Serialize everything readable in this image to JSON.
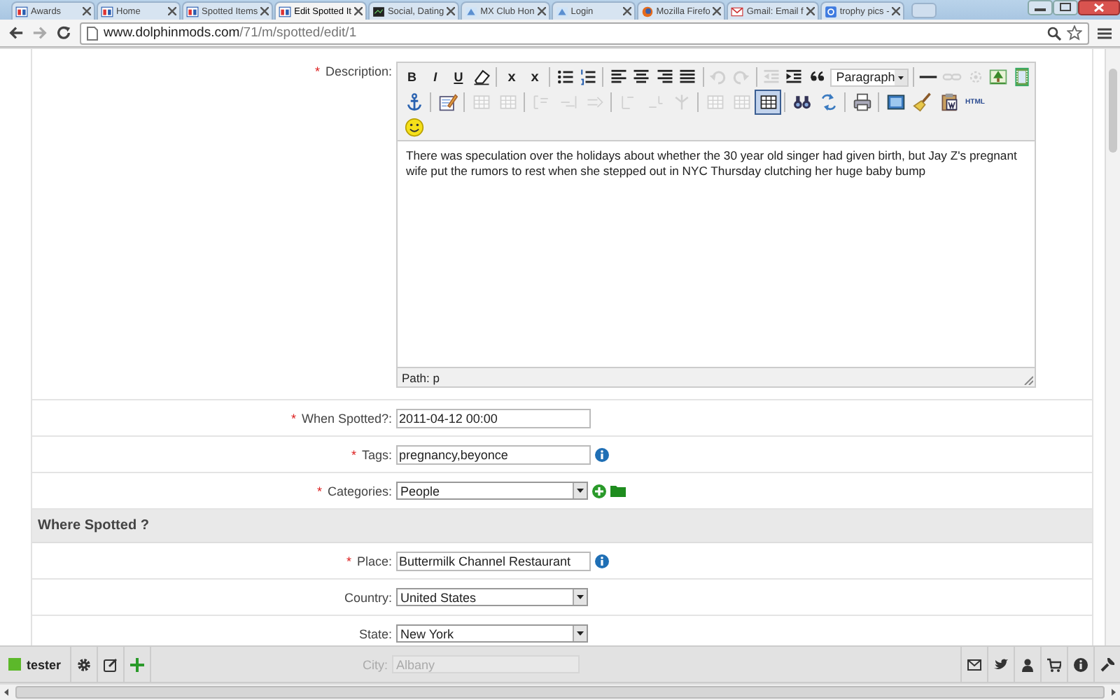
{
  "browser": {
    "tabs": [
      {
        "label": "Awards",
        "selected": false
      },
      {
        "label": "Home",
        "selected": false
      },
      {
        "label": "Spotted Items",
        "selected": false
      },
      {
        "label": "Edit Spotted It",
        "selected": true
      },
      {
        "label": "Social, Dating",
        "selected": false
      },
      {
        "label": "MX Club Hon",
        "selected": false
      },
      {
        "label": "Login",
        "selected": false
      },
      {
        "label": "Mozilla Firefo",
        "selected": false
      },
      {
        "label": "Gmail: Email f",
        "selected": false
      },
      {
        "label": "trophy pics -",
        "selected": false
      }
    ],
    "address": {
      "host": "www.dolphinmods.com",
      "path": "/71/m/spotted/edit/1"
    }
  },
  "description": {
    "label": "Description:",
    "marker": "*",
    "toolbar_rows": [
      [
        {
          "kind": "bold",
          "label": "B",
          "disabled": false,
          "active": false
        },
        {
          "kind": "italic",
          "label": "I",
          "disabled": false,
          "active": false
        },
        {
          "kind": "underline",
          "label": "U",
          "disabled": false,
          "active": false
        },
        {
          "kind": "eraser",
          "disabled": false,
          "active": false
        },
        {
          "kind": "separator"
        },
        {
          "kind": "subscript",
          "label": "x",
          "disabled": false,
          "active": false
        },
        {
          "kind": "superscript",
          "label": "x",
          "disabled": false,
          "active": false
        },
        {
          "kind": "separator"
        },
        {
          "kind": "bullets",
          "disabled": false,
          "active": false
        },
        {
          "kind": "numbers",
          "disabled": false,
          "active": false
        },
        {
          "kind": "separator"
        },
        {
          "kind": "align-left",
          "disabled": false,
          "active": false
        },
        {
          "kind": "align-center",
          "disabled": false,
          "active": false
        },
        {
          "kind": "align-right",
          "disabled": false,
          "active": false
        },
        {
          "kind": "align-justify",
          "disabled": false,
          "active": false
        },
        {
          "kind": "separator"
        },
        {
          "kind": "undo",
          "disabled": true,
          "active": false
        },
        {
          "kind": "redo",
          "disabled": true,
          "active": false
        },
        {
          "kind": "separator"
        },
        {
          "kind": "outdent",
          "disabled": true,
          "active": false
        },
        {
          "kind": "indent",
          "disabled": false,
          "active": false
        },
        {
          "kind": "quote",
          "disabled": false,
          "active": false
        },
        {
          "kind": "format",
          "value": "Paragraph"
        },
        {
          "kind": "separator"
        },
        {
          "kind": "rule",
          "disabled": false,
          "active": false
        },
        {
          "kind": "link",
          "disabled": true,
          "active": false
        },
        {
          "kind": "unlink",
          "disabled": true,
          "active": false
        },
        {
          "kind": "image",
          "disabled": false,
          "active": false
        },
        {
          "kind": "media",
          "disabled": false,
          "active": false
        }
      ],
      [
        {
          "kind": "anchor",
          "disabled": false,
          "active": false
        },
        {
          "kind": "separator"
        },
        {
          "kind": "edit",
          "disabled": false,
          "active": false
        },
        {
          "kind": "separator"
        },
        {
          "kind": "table-row",
          "disabled": true,
          "active": false
        },
        {
          "kind": "table-cell",
          "disabled": true,
          "active": false
        },
        {
          "kind": "separator"
        },
        {
          "kind": "col-before",
          "disabled": true,
          "active": false
        },
        {
          "kind": "col-after",
          "disabled": true,
          "active": false
        },
        {
          "kind": "col-delete",
          "disabled": true,
          "active": false
        },
        {
          "kind": "separator"
        },
        {
          "kind": "split",
          "disabled": true,
          "active": false
        },
        {
          "kind": "merge",
          "disabled": true,
          "active": false
        },
        {
          "kind": "merge-delete",
          "disabled": true,
          "active": false
        },
        {
          "kind": "separator"
        },
        {
          "kind": "table-row",
          "disabled": true,
          "active": false
        },
        {
          "kind": "table-cell",
          "disabled": true,
          "active": false
        },
        {
          "kind": "table",
          "disabled": false,
          "active": true
        },
        {
          "kind": "separator"
        },
        {
          "kind": "find",
          "disabled": false,
          "active": false
        },
        {
          "kind": "replace",
          "disabled": false,
          "active": false
        },
        {
          "kind": "separator"
        },
        {
          "kind": "print",
          "disabled": false,
          "active": false
        },
        {
          "kind": "separator"
        },
        {
          "kind": "fullscreen",
          "disabled": false,
          "active": false
        },
        {
          "kind": "cleanup",
          "disabled": false,
          "active": false
        },
        {
          "kind": "paste-word",
          "disabled": false,
          "active": false
        },
        {
          "kind": "html",
          "label": "HTML",
          "disabled": false,
          "active": false
        }
      ],
      [
        {
          "kind": "emoticon",
          "disabled": false,
          "active": false
        }
      ]
    ],
    "content": "There was speculation over the holidays about whether the 30 year old singer had given birth, but Jay Z's pregnant wife put the rumors to rest when she stepped out in NYC Thursday clutching her huge baby bump",
    "path": "Path: p"
  },
  "sections": [
    {
      "fields": [
        {
          "label": "When Spotted?:",
          "marker": "*",
          "kind": "text",
          "value": "2011-04-12 00:00"
        },
        {
          "label": "Tags:",
          "marker": "*",
          "kind": "text-info",
          "value": "pregnancy,beyonce"
        },
        {
          "label": "Categories:",
          "marker": "*",
          "kind": "select-add",
          "value": "People"
        }
      ]
    },
    {
      "title": "Where Spotted ?",
      "fields": [
        {
          "label": "Place:",
          "marker": "*",
          "kind": "text-info",
          "value": "Buttermilk Channel Restaurant"
        },
        {
          "label": "Country:",
          "kind": "select",
          "value": "United States"
        },
        {
          "label": "State:",
          "kind": "select",
          "value": "New York"
        }
      ]
    }
  ],
  "hidden_row": {
    "label": "City:",
    "value": "Albany"
  },
  "user_bar": {
    "user": "tester"
  }
}
